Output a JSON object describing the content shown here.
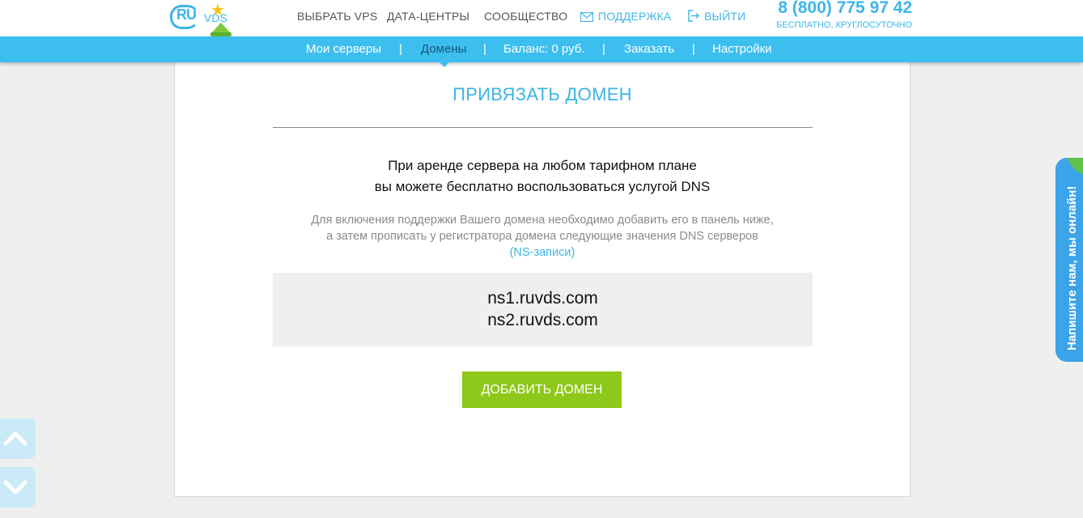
{
  "header": {
    "logo_text_ru": "RU",
    "logo_text_vds": "VDS",
    "nav": [
      {
        "label": "Выбрать VPS"
      },
      {
        "label": "Дата-центры"
      },
      {
        "label": "Сообщество"
      },
      {
        "label": "Поддержка",
        "icon": "envelope-icon"
      },
      {
        "label": "Выйти",
        "icon": "logout-icon"
      }
    ],
    "phone": "8 (800) 775 97 42",
    "phone_note": "Бесплатно, круглосуточно"
  },
  "menu": {
    "items": [
      {
        "label": "Мои серверы",
        "active": false
      },
      {
        "label": "Домены",
        "active": true
      },
      {
        "label": "Баланс: 0 руб.",
        "active": false
      },
      {
        "label": "Заказать",
        "active": false
      },
      {
        "label": "Настройки",
        "active": false
      }
    ],
    "separator": "|"
  },
  "content": {
    "title": "Привязать домен",
    "lead_line1": "При аренде сервера на любом тарифном плане",
    "lead_line2": "вы можете бесплатно воспользоваться услугой DNS",
    "info_line1": "Для включения поддержки Вашего домена необходимо добавить его в панель ниже,",
    "info_line2": "а затем прописать у регистратора домена следующие значения DNS серверов",
    "info_link": "(NS-записи)",
    "ns_servers": [
      "ns1.ruvds.com",
      "ns2.ruvds.com"
    ],
    "add_button": "Добавить домен"
  },
  "chat": {
    "label": "Напишите нам, мы онлайн!"
  },
  "colors": {
    "accent": "#3cbfef",
    "button_green": "#8dc81a",
    "chat_blue": "#3ba3e8"
  }
}
